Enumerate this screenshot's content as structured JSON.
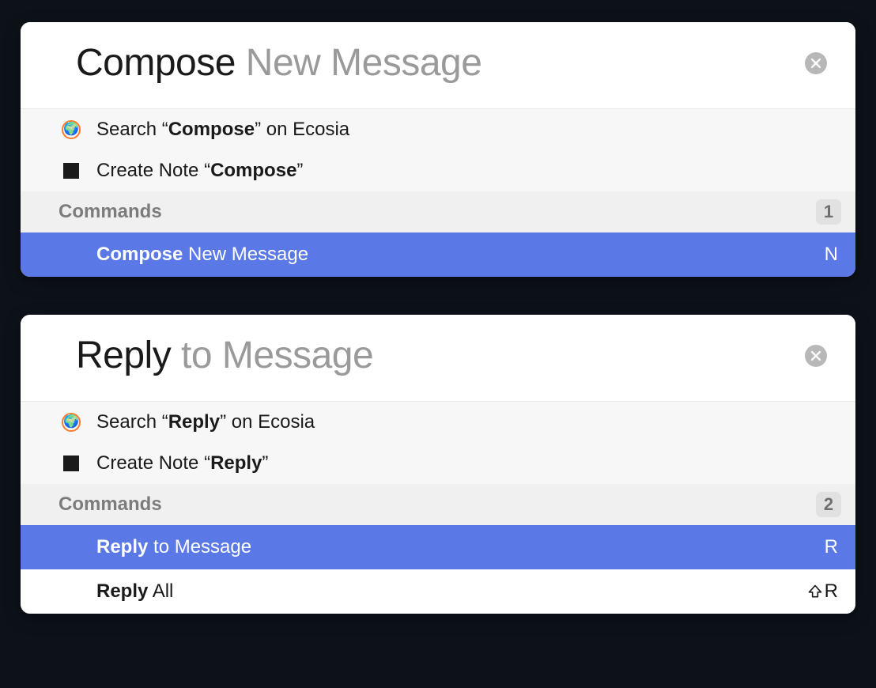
{
  "panels": [
    {
      "title_bold": "Compose",
      "title_rest": " New Message",
      "suggestions": [
        {
          "icon": "globe",
          "prefix": "Search “",
          "bold": "Compose",
          "suffix": "” on Ecosia"
        },
        {
          "icon": "note",
          "prefix": "Create Note “",
          "bold": "Compose",
          "suffix": "”"
        }
      ],
      "section_label": "Commands",
      "count": "1",
      "commands": [
        {
          "bold": "Compose",
          "rest": " New Message",
          "shortcut": "N",
          "shift": false,
          "selected": true
        }
      ]
    },
    {
      "title_bold": "Reply",
      "title_rest": " to Message",
      "suggestions": [
        {
          "icon": "globe",
          "prefix": "Search “",
          "bold": "Reply",
          "suffix": "” on Ecosia"
        },
        {
          "icon": "note",
          "prefix": "Create Note “",
          "bold": "Reply",
          "suffix": "”"
        }
      ],
      "section_label": "Commands",
      "count": "2",
      "commands": [
        {
          "bold": "Reply",
          "rest": " to Message",
          "shortcut": "R",
          "shift": false,
          "selected": true
        },
        {
          "bold": "Reply",
          "rest": " All",
          "shortcut": "R",
          "shift": true,
          "selected": false
        }
      ]
    }
  ]
}
